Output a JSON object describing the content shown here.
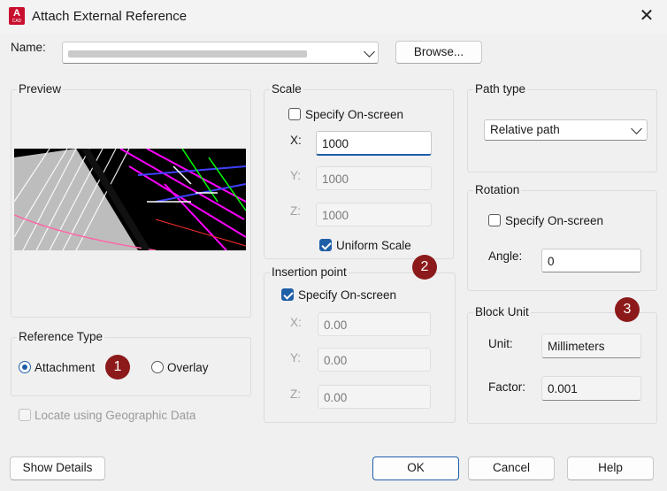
{
  "window": {
    "title": "Attach External Reference",
    "logo_text": "A",
    "logo_sub": "CAD"
  },
  "name": {
    "label": "Name:",
    "value": "",
    "browse_label": "Browse..."
  },
  "preview": {
    "label": "Preview"
  },
  "scale": {
    "label": "Scale",
    "specify_label": "Specify On-screen",
    "specify_checked": false,
    "x_label": "X:",
    "x_value": "1000",
    "y_label": "Y:",
    "y_value": "1000",
    "z_label": "Z:",
    "z_value": "1000",
    "uniform_label": "Uniform Scale",
    "uniform_checked": true
  },
  "insertion": {
    "label": "Insertion point",
    "specify_label": "Specify On-screen",
    "specify_checked": true,
    "x_label": "X:",
    "x_value": "0.00",
    "y_label": "Y:",
    "y_value": "0.00",
    "z_label": "Z:",
    "z_value": "0.00"
  },
  "path_type": {
    "label": "Path type",
    "selected": "Relative path"
  },
  "rotation": {
    "label": "Rotation",
    "specify_label": "Specify On-screen",
    "specify_checked": false,
    "angle_label": "Angle:",
    "angle_value": "0"
  },
  "block_unit": {
    "label": "Block Unit",
    "unit_label": "Unit:",
    "unit_value": "Millimeters",
    "factor_label": "Factor:",
    "factor_value": "0.001"
  },
  "reference_type": {
    "label": "Reference Type",
    "attachment_label": "Attachment",
    "overlay_label": "Overlay",
    "selected": "Attachment"
  },
  "geo": {
    "label": "Locate using Geographic Data",
    "checked": false
  },
  "badges": [
    "1",
    "2",
    "3"
  ],
  "footer": {
    "show_details": "Show Details",
    "ok": "OK",
    "cancel": "Cancel",
    "help": "Help"
  },
  "colors": {
    "accent": "#1f5fa8",
    "badge": "#8c1a1a",
    "logo": "#c8102e"
  }
}
